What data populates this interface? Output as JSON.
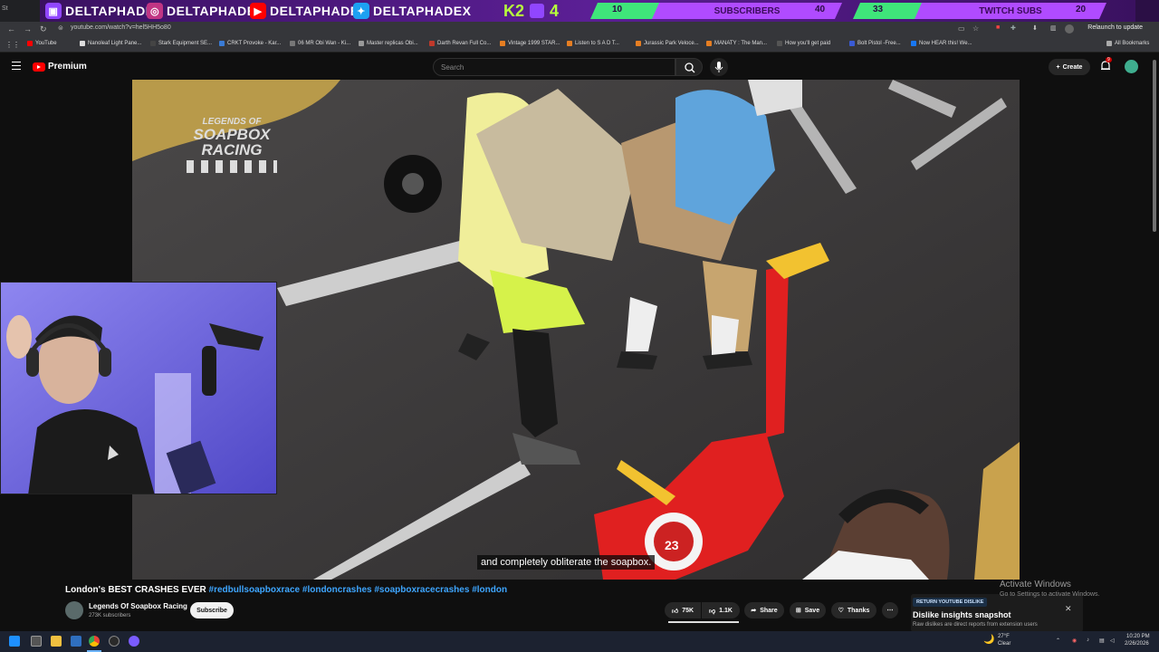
{
  "stream_banner": {
    "socials": [
      "DELTAPHADE",
      "DELTAPHADE",
      "DELTAPHADE",
      "DELTAPHADEX"
    ],
    "k2_digit": "4",
    "goals": [
      {
        "start": "10",
        "label": "SUBSCRIBERS",
        "target": "40"
      },
      {
        "start": "33",
        "label": "TWITCH SUBS",
        "target": "20"
      }
    ]
  },
  "browser": {
    "url": "youtube.com/watch?v=hel5HH5o80",
    "relaunch": "Relaunch to update",
    "bookmarks": [
      "YouTube",
      "Nanoleaf Light Pane...",
      "Stark Equipment SE...",
      "CRKT Provoke - Kar...",
      "06 MR Obi Wan - Ki...",
      "Master replicas Obi...",
      "Darth Revan Full Co...",
      "Vintage 1999 STAR...",
      "Listen to S A D T...",
      "Jurassic Park Veloce...",
      "MANATY : The Man...",
      "How you'll get paid",
      "Bolt Pistol -Free...",
      "Now HEAR this! We..."
    ],
    "all_bookmarks": "All Bookmarks"
  },
  "youtube": {
    "logo_text": "Premium",
    "search_placeholder": "Search",
    "create_label": "Create",
    "notif_count": "9"
  },
  "video": {
    "watermark_line1": "LEGENDS OF",
    "watermark_line2": "SOAPBOX",
    "watermark_line3": "RACING",
    "car_number": "23",
    "subtitle": "and completely obliterate the soapbox.",
    "title_text": "London's BEST CRASHES EVER ",
    "title_tags": "#redbullsoapboxrace #londoncrashes #soapboxracecrashes #london",
    "channel_name": "Legends Of Soapbox Racing",
    "channel_subs": "273K subscribers",
    "subscribe_label": "Subscribe",
    "likes": "75K",
    "dislikes": "1.1K",
    "share_label": "Share",
    "save_label": "Save",
    "thanks_label": "Thanks"
  },
  "dislike_panel": {
    "tag": "RETURN YOUTUBE DISLIKE",
    "title": "Dislike insights snapshot",
    "subtitle": "Raw dislikes are direct reports from extension users"
  },
  "windows_watermark": {
    "line1": "Activate Windows",
    "line2": "Go to Settings to activate Windows."
  },
  "taskbar": {
    "weather_temp": "27°F",
    "weather_desc": "Clear",
    "time": "10:20 PM",
    "date": "2/26/2026"
  },
  "colors": {
    "youtube_red": "#ff0000",
    "banner_purple": "#5b1f95",
    "goal_green": "#3fe57a",
    "goal_purple": "#b04bff",
    "hashtag_blue": "#3ea6ff"
  }
}
